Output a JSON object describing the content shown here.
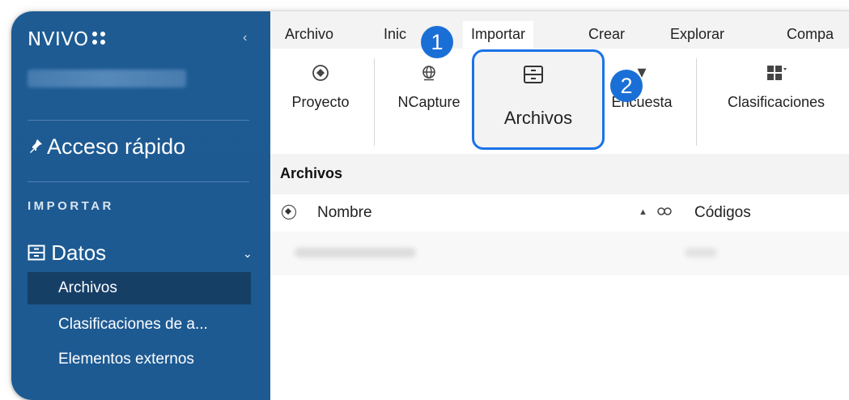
{
  "app": {
    "logo": "NVIVO"
  },
  "sidebar": {
    "quick_access": "Acceso rápido",
    "section_label": "IMPORTAR",
    "group_label": "Datos",
    "items": [
      {
        "label": "Archivos",
        "active": true
      },
      {
        "label": "Clasificaciones de a..."
      },
      {
        "label": "Elementos externos"
      }
    ]
  },
  "menu": {
    "items": [
      "Archivo",
      "Inic",
      "Importar",
      "Crear",
      "Explorar",
      "Compa"
    ],
    "active": "Importar"
  },
  "ribbon": {
    "buttons": [
      {
        "label": "Proyecto",
        "icon": "add-circle-icon"
      },
      {
        "label": "NCapture",
        "icon": "globe-icon"
      },
      {
        "label": "Archivos",
        "icon": "file-cabinet-icon",
        "highlighted": true
      },
      {
        "label": "Encuesta",
        "icon": "survey-icon"
      },
      {
        "label": "Clasificaciones",
        "icon": "grid-icon"
      }
    ]
  },
  "callouts": {
    "step1": "1",
    "step2": "2"
  },
  "content": {
    "title": "Archivos",
    "columns": {
      "name": "Nombre",
      "codes": "Códigos"
    }
  },
  "colors": {
    "sidebar": "#1e5b93",
    "highlight": "#1a73e8",
    "badge": "#1a6fd6"
  }
}
